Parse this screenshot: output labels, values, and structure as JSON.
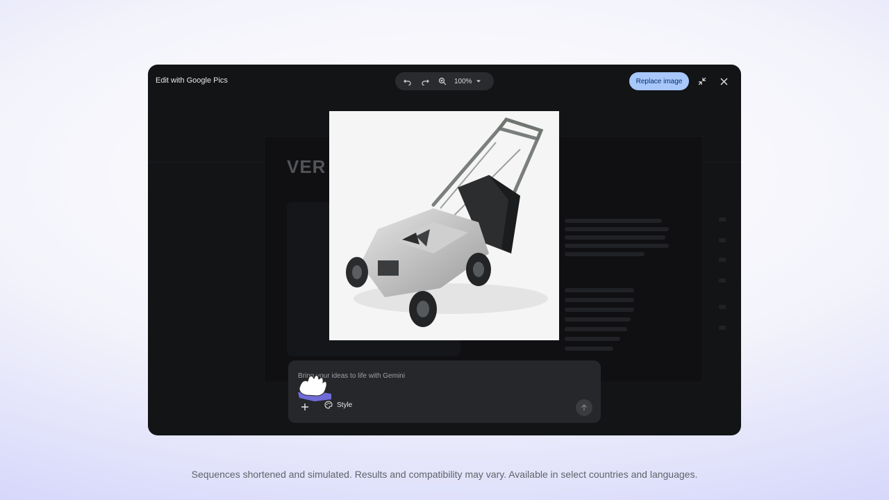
{
  "dialog": {
    "title": "Edit with Google Pics",
    "zoom_level": "100%",
    "replace_label": "Replace image",
    "icons": [
      "undo-icon",
      "redo-icon",
      "zoom-in-icon",
      "chevron-down-icon",
      "collapse-icon",
      "close-icon"
    ]
  },
  "prompt": {
    "placeholder": "Bring your ideas to life with Gemini",
    "style_label": "Style"
  },
  "footer": {
    "disclaimer": "Sequences shortened and simulated. Results and compatibility may vary. Available in select countries and languages."
  },
  "colors": {
    "accent": "#a8c7fa",
    "dialog_bg": "#131416",
    "panel_bg": "#26272a"
  }
}
